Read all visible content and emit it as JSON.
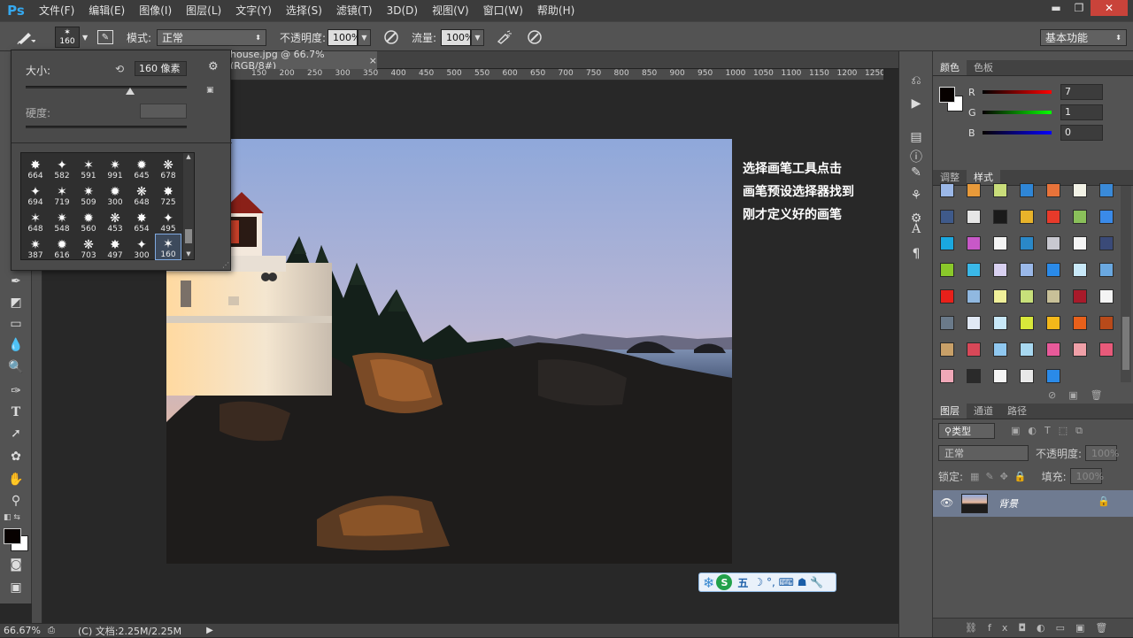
{
  "app": {
    "logo": "Ps"
  },
  "menu": [
    "文件(F)",
    "编辑(E)",
    "图像(I)",
    "图层(L)",
    "文字(Y)",
    "选择(S)",
    "滤镜(T)",
    "3D(D)",
    "视图(V)",
    "窗口(W)",
    "帮助(H)"
  ],
  "window_controls": {
    "minimize": "▬",
    "restore": "❐",
    "close": "✕"
  },
  "options_bar": {
    "brush_size": "160",
    "mode_label": "模式:",
    "mode_value": "正常",
    "opacity_label": "不透明度:",
    "opacity_value": "100%",
    "flow_label": "流量:",
    "flow_value": "100%",
    "workspace": "基本功能"
  },
  "brush_popup": {
    "size_label": "大小:",
    "size_value": "160 像素",
    "hardness_label": "硬度:",
    "size_slider_fraction": 0.65,
    "presets": [
      [
        "664",
        "582",
        "591",
        "991",
        "645",
        "678"
      ],
      [
        "694",
        "719",
        "509",
        "300",
        "648",
        "725"
      ],
      [
        "648",
        "548",
        "560",
        "453",
        "654",
        "495"
      ],
      [
        "387",
        "616",
        "703",
        "497",
        "300",
        "160"
      ]
    ],
    "selected_preset": "160"
  },
  "document": {
    "tab_title": "house.jpg @ 66.7%(RGB/8#)",
    "tab_close": "×",
    "ruler_marks": [
      "150",
      "200",
      "250",
      "300",
      "350",
      "400",
      "450",
      "500",
      "550",
      "600",
      "650",
      "700",
      "750",
      "800",
      "850",
      "900",
      "950",
      "1000",
      "1050",
      "1100",
      "1150",
      "1200",
      "1250"
    ]
  },
  "instruction": {
    "lines": [
      "选择画笔工具点击",
      "画笔预设选择器找到",
      "刚才定义好的画笔"
    ]
  },
  "ime_bar": {
    "label": "五",
    "extras": "☽ °, ⌨ ☗ 🔧"
  },
  "status": {
    "zoom": "66.67%",
    "doc": "(C) 文档:2.25M/2.25M"
  },
  "color_panel": {
    "tabs": [
      "颜色",
      "色板"
    ],
    "r_label": "R",
    "r_value": "7",
    "g_label": "G",
    "g_value": "1",
    "b_label": "B",
    "b_value": "0"
  },
  "styles_panel": {
    "tabs": [
      "调整",
      "样式"
    ],
    "swatch_colors": [
      "#9bb8e8",
      "#e89a3a",
      "#c9dd7a",
      "#2f86d6",
      "#e8733a",
      "#f2f2e6",
      "#3a8ad8",
      "#3f5a8a",
      "#e6e6e6",
      "#1a1a1a",
      "#e8b32a",
      "#e83a2a",
      "#8ac05a",
      "#3a8ae8",
      "#1aa8e0",
      "#c858c8",
      "#f4f4f4",
      "#2a88c8",
      "#c8c8d0",
      "#f4f4f4",
      "#3a4a78",
      "#8ac82a",
      "#3ab8e8",
      "#d8d0f0",
      "#9ab8e8",
      "#2a8ae8",
      "#c8e8f8",
      "#6aa8e0",
      "#e8201a",
      "#90b8e0",
      "#f0f09a",
      "#c8e07a",
      "#c8c098",
      "#a81a2a",
      "#f4f4f4",
      "#6a7a8a",
      "#e0e8f4",
      "#c8e8f8",
      "#d8e83a",
      "#f4b81a",
      "#e8601a",
      "#b84a1a",
      "#c8a068",
      "#d84858",
      "#90c8f0",
      "#a8d8f0",
      "#e85a9a",
      "#f0a0a8",
      "#e85a7a",
      "#f0a8b8",
      "#2a2a2a",
      "#f4f4f4",
      "#e8e8e8",
      "#2a8ae8"
    ]
  },
  "layers_panel": {
    "tabs": [
      "图层",
      "通道",
      "路径"
    ],
    "filter": "类型",
    "blend": "正常",
    "opacity_label": "不透明度:",
    "opacity_value": "100%",
    "lock_label": "锁定:",
    "fill_label": "填充:",
    "fill_value": "100%",
    "layer_name": "背景"
  }
}
